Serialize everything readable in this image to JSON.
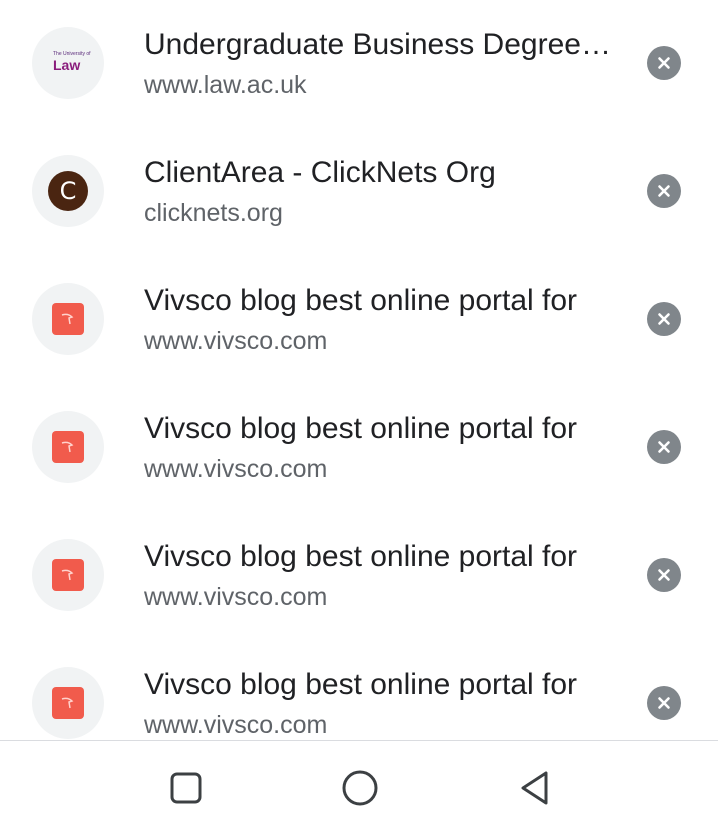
{
  "history": {
    "items": [
      {
        "title": "Undergraduate Business Degrees | The University of Law",
        "url": "www.law.ac.uk",
        "favicon": "university-of-law-logo",
        "favicon_text_small": "The University of",
        "favicon_text_big": "Law"
      },
      {
        "title": "ClientArea - ClickNets Org",
        "url": "clicknets.org",
        "favicon": "letter-avatar",
        "favicon_letter": "C"
      },
      {
        "title": "Vivsco blog best online portal for",
        "url": "www.vivsco.com",
        "favicon": "vivsco-logo"
      },
      {
        "title": "Vivsco blog best online portal for",
        "url": "www.vivsco.com",
        "favicon": "vivsco-logo"
      },
      {
        "title": "Vivsco blog best online portal for",
        "url": "www.vivsco.com",
        "favicon": "vivsco-logo"
      },
      {
        "title": "Vivsco blog best online portal for",
        "url": "www.vivsco.com",
        "favicon": "vivsco-logo"
      }
    ],
    "remove_icon": "close-circle-icon"
  },
  "navigation_bar": {
    "buttons": [
      "recents-square-icon",
      "home-circle-icon",
      "back-triangle-icon"
    ]
  },
  "colors": {
    "title": "#202124",
    "url": "#5f6368",
    "remove_button": "#80868b",
    "favicon_bg": "#f1f3f4",
    "vivsco_brand": "#f15b4c",
    "clicknets_avatar": "#4a2511",
    "law_brand": "#8a1c7c"
  }
}
